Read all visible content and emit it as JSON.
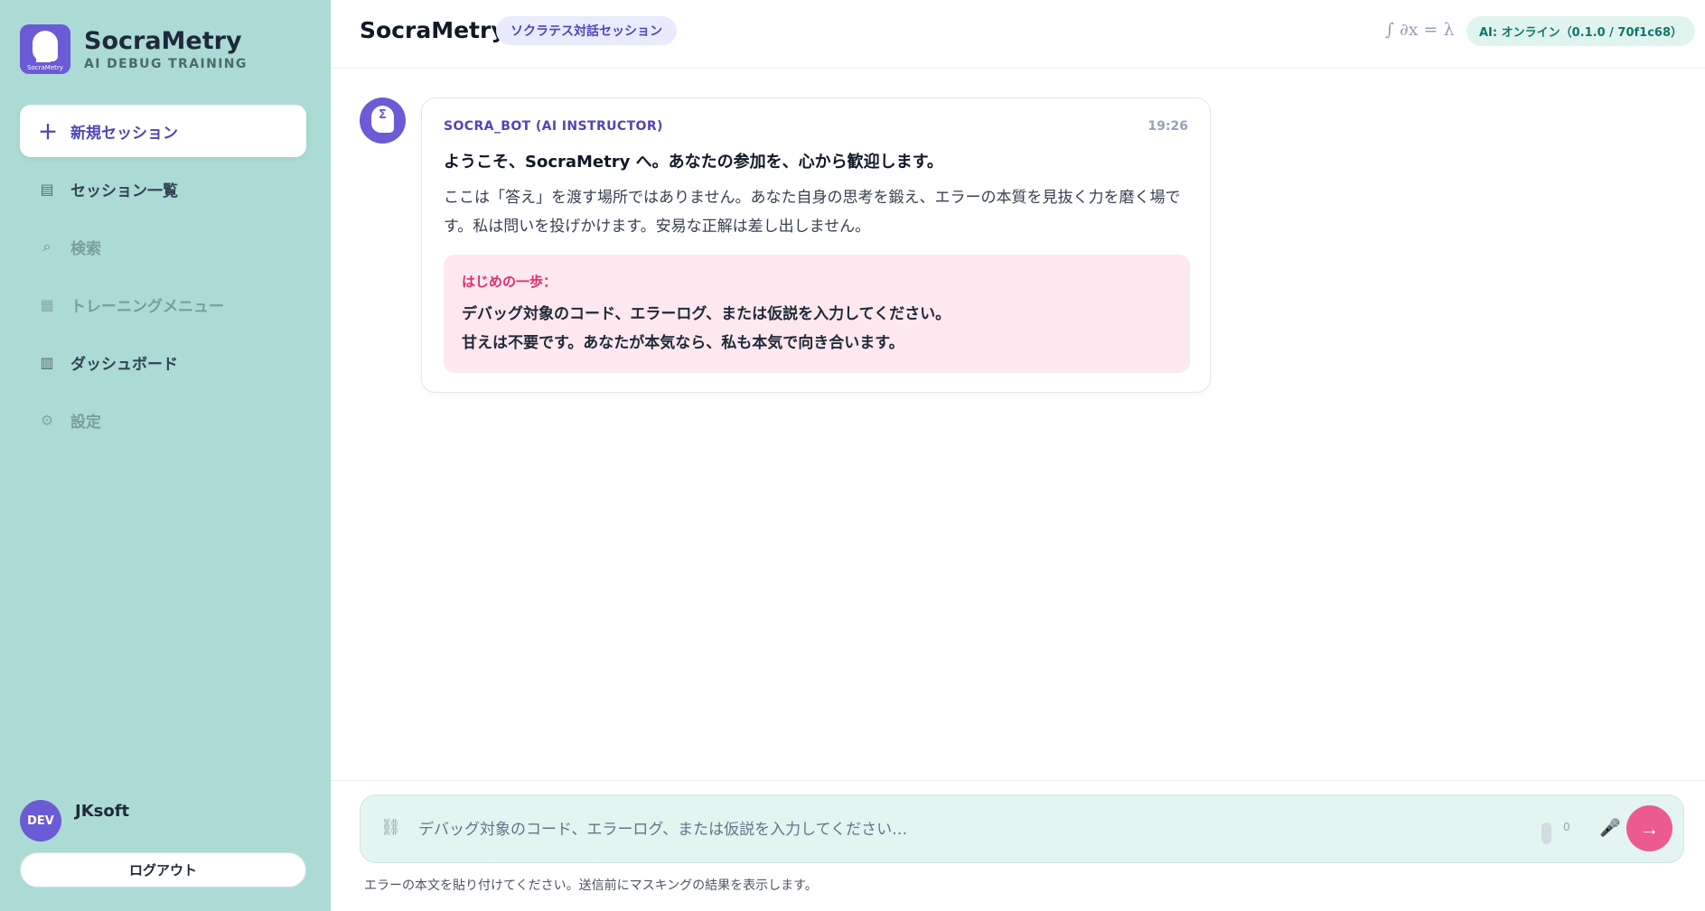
{
  "brand": {
    "title": "SocraMetry",
    "subtitle": "AI DEBUG TRAINING",
    "logo_caption": "SocraMetry"
  },
  "nav": {
    "new_session": "新規セッション",
    "sessions": "セッション一覧",
    "search": "検索",
    "training": "トレーニングメニュー",
    "dashboard": "ダッシュボード",
    "settings": "設定"
  },
  "user": {
    "avatar": "DEV",
    "name": "JKsoft",
    "logout": "ログアウト"
  },
  "header": {
    "title": "SocraMetry",
    "badge": "ソクラテス対話セッション",
    "math": "∫ ∂x = λ",
    "status": "AI: オンライン（0.1.0 / 70f1c68）"
  },
  "message": {
    "avatar_symbol": "Σ",
    "sender": "SOCRA_BOT (AI INSTRUCTOR)",
    "time": "19:26",
    "title": "ようこそ、SocraMetry へ。あなたの参加を、心から歓迎します。",
    "body": "ここは「答え」を渡す場所ではありません。あなた自身の思考を鍛え、エラーの本質を見抜く力を磨く場です。私は問いを投げかけます。安易な正解は差し出しません。",
    "tip_title": "はじめの一歩：",
    "tip_line1": "デバッグ対象のコード、エラーログ、または仮説を入力してください。",
    "tip_line2": "甘えは不要です。あなたが本気なら、私も本気で向き合います。"
  },
  "composer": {
    "placeholder": "デバッグ対象のコード、エラーログ、または仮説を入力してください…",
    "value": "",
    "counter": "0",
    "hint": "エラーの本文を貼り付けてください。送信前にマスキングの結果を表示します。"
  },
  "icons": {
    "plus": "＋",
    "list": "▤",
    "search": "⌕",
    "grid": "▦",
    "dashboard": "▥",
    "gear": "⚙",
    "clip": "⛓",
    "mic": "🎤",
    "send": "→"
  },
  "colors": {
    "sidebar": "#acdbd6",
    "accent": "#6b5bd6",
    "send": "#ec5a8f",
    "tip_bg": "#fde8ef"
  }
}
